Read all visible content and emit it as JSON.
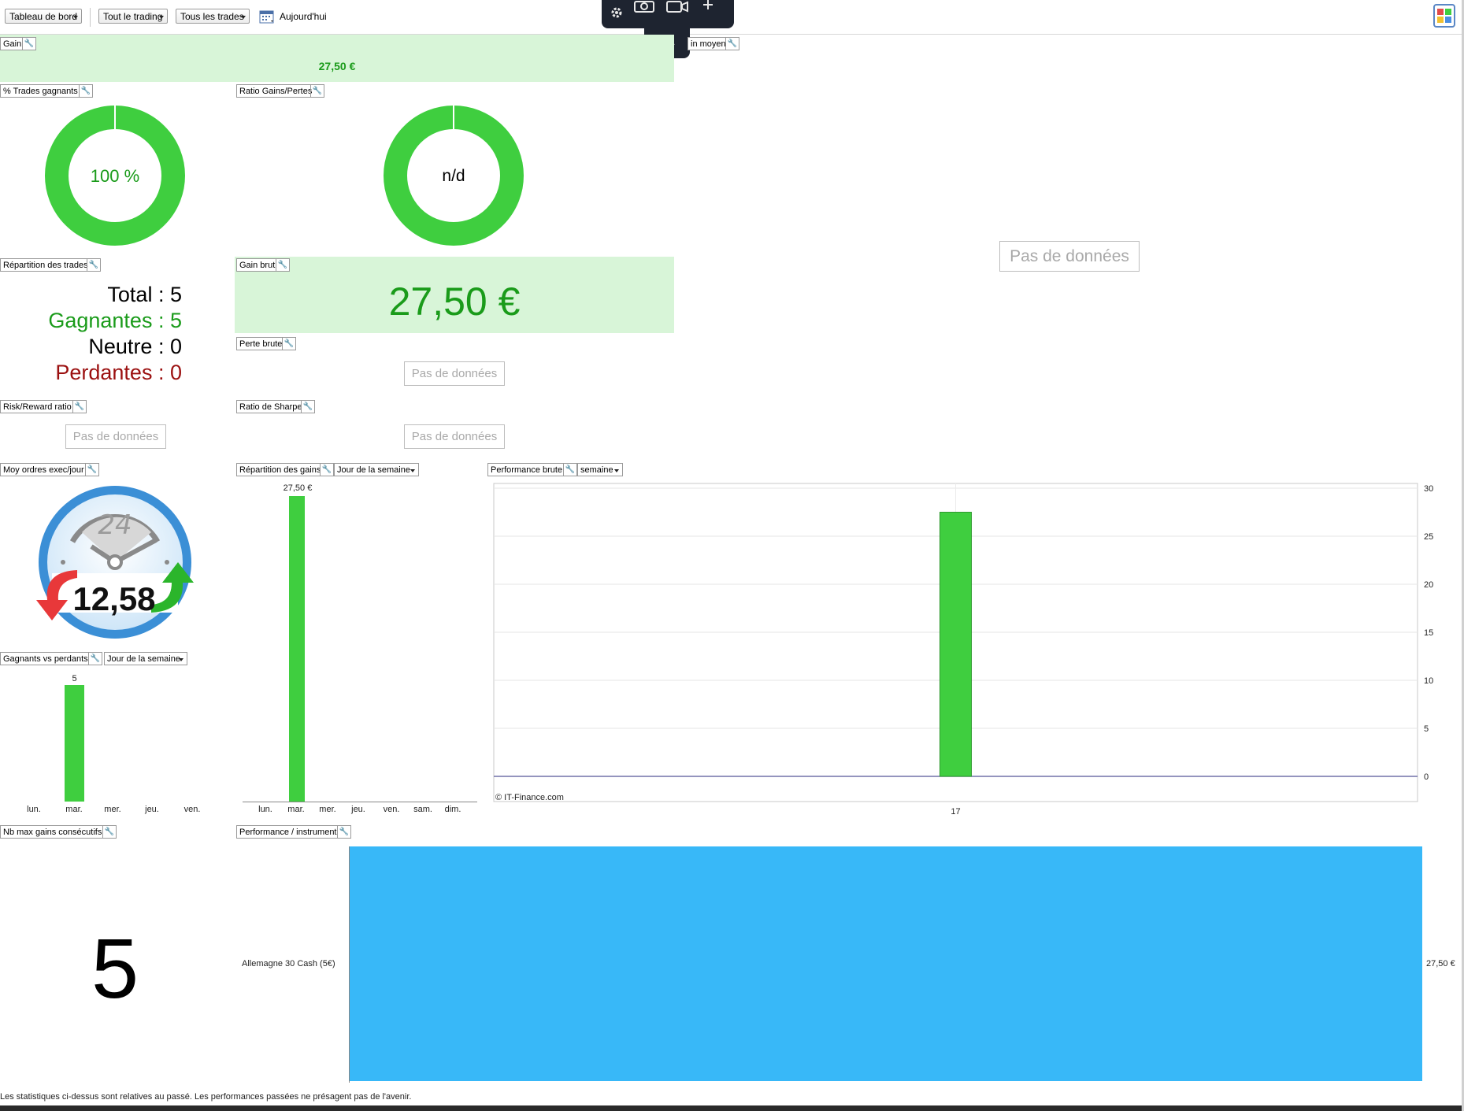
{
  "toolbar": {
    "dashboard_select": "Tableau de bord",
    "trading_select": "Tout le trading",
    "trades_select": "Tous les trades",
    "date_label": "Aujourd'hui"
  },
  "widgets": {
    "gain": {
      "title": "Gain",
      "value": "27,50 €"
    },
    "gain_moyen": {
      "title": "in moyen",
      "nodata": "Pas de données"
    },
    "pct_winning": {
      "title": "% Trades gagnants",
      "value": "100 %",
      "percent": 100
    },
    "ratio_gains_pertes": {
      "title": "Ratio Gains/Pertes",
      "value": "n/d"
    },
    "repartition_trades": {
      "title": "Répartition des trades",
      "total_label": "Total",
      "total_value": "5",
      "winners_label": "Gagnantes",
      "winners_value": "5",
      "neutral_label": "Neutre",
      "neutral_value": "0",
      "losers_label": "Perdantes",
      "losers_value": "0",
      "sep": " : "
    },
    "gain_brut": {
      "title": "Gain brut",
      "value": "27,50 €"
    },
    "perte_brute": {
      "title": "Perte brute",
      "nodata": "Pas de données"
    },
    "risk_reward": {
      "title": "Risk/Reward ratio",
      "nodata": "Pas de données"
    },
    "sharpe": {
      "title": "Ratio de Sharpe",
      "nodata": "Pas de données"
    },
    "moy_ordres": {
      "title": "Moy ordres exec/jour",
      "dial_number": "24",
      "value": "12,58"
    },
    "repartition_gains": {
      "title": "Répartition des gains",
      "period": "Jour de la semaine",
      "days": [
        "lun.",
        "mar.",
        "mer.",
        "jeu.",
        "ven.",
        "sam.",
        "dim."
      ],
      "values": [
        0,
        27.5,
        0,
        0,
        0,
        0,
        0
      ],
      "bar_label": "27,50 €"
    },
    "performance_brute": {
      "title": "Performance brute",
      "period": "semaine",
      "copyright": "© IT-Finance.com"
    },
    "gagnants_vs_perdants": {
      "title": "Gagnants vs perdants",
      "period": "Jour de la semaine",
      "days": [
        "lun.",
        "mar.",
        "mer.",
        "jeu.",
        "ven."
      ],
      "values": [
        0,
        5,
        0,
        0,
        0
      ],
      "bar_label": "5"
    },
    "max_gains_consecutifs": {
      "title": "Nb max gains consécutifs",
      "value": "5"
    },
    "perf_instrument": {
      "title": "Performance / instrument",
      "instrument": "Allemagne 30 Cash (5€)",
      "value_label": "27,50 €",
      "color": "#38b8f8"
    }
  },
  "chart_data": [
    {
      "type": "bar",
      "title": "Performance brute",
      "categories": [
        "17"
      ],
      "values": [
        27.5
      ],
      "ylim": [
        0,
        30
      ],
      "yticks": [
        "0",
        "5",
        "10",
        "15",
        "20",
        "25",
        "30"
      ],
      "grid": true,
      "color": "#3fce3f"
    }
  ],
  "footer": {
    "disclaimer": "Les statistiques ci-dessus sont relatives au passé. Les performances passées ne présagent pas de l'avenir."
  },
  "colors": {
    "green": "#3fce3f",
    "dark_green": "#1a9b1a",
    "red": "#9b1010",
    "band": "#d8f5d8"
  }
}
